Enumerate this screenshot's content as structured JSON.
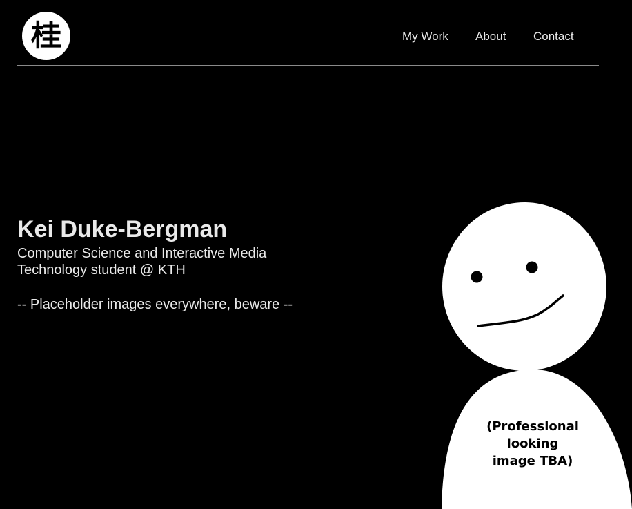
{
  "header": {
    "logo_glyph": "桂",
    "nav": [
      {
        "label": "My Work"
      },
      {
        "label": "About"
      },
      {
        "label": "Contact"
      }
    ]
  },
  "hero": {
    "name": "Kei Duke-Bergman",
    "subtitle": "Computer Science and Interactive Media Technology student @ KTH",
    "note": "-- Placeholder images everywhere, beware --"
  },
  "portrait": {
    "caption": "(Professional\nlooking\nimage TBA)"
  },
  "colors": {
    "background": "#000000",
    "text": "#e9e9e9",
    "divider": "#8a8a8a",
    "figure": "#ffffff"
  }
}
